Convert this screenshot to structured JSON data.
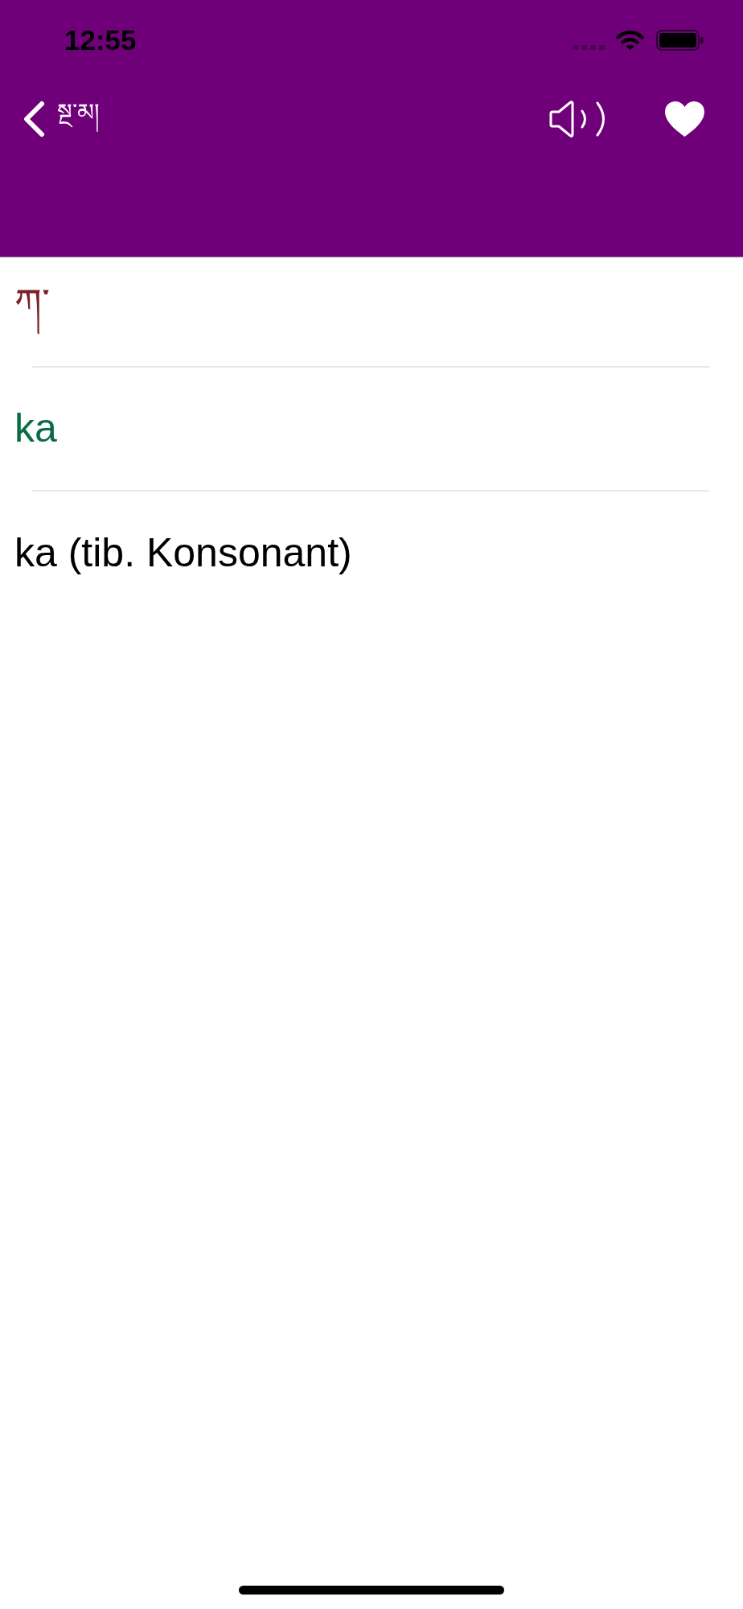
{
  "status_bar": {
    "time": "12:55"
  },
  "nav_bar": {
    "back_label": "སྔ་མ།"
  },
  "entries": [
    {
      "kind": "tibetan",
      "text": "ཀ་"
    },
    {
      "kind": "transliteration",
      "text": "ka"
    },
    {
      "kind": "translation",
      "text": "ka (tib. Konsonant)"
    }
  ]
}
